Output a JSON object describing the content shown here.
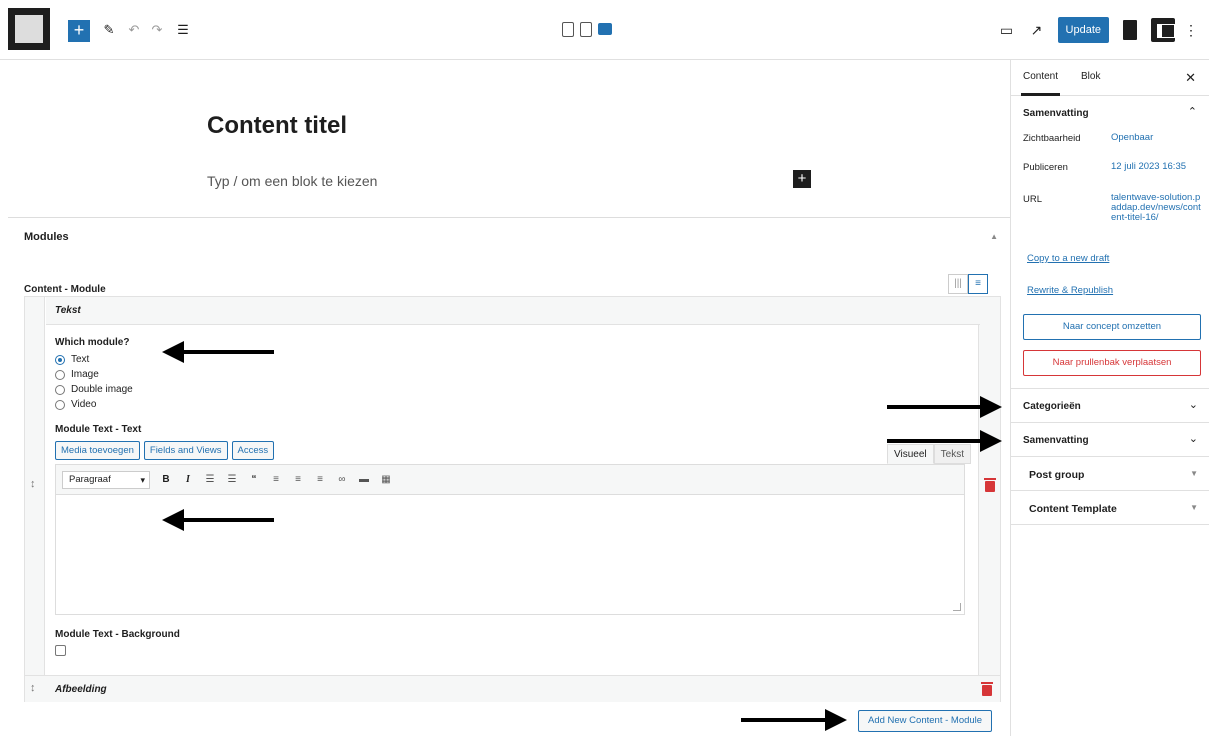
{
  "toolbar": {
    "add_icon": "+",
    "edit_icon": "pencil-icon",
    "undo_icon": "undo-icon",
    "redo_icon": "redo-icon",
    "list_view_icon": "list-view-icon",
    "update_label": "Update"
  },
  "post": {
    "title": "Content titel",
    "block_placeholder": "Typ / om een blok te kiezen"
  },
  "modules": {
    "header": "Modules",
    "group_label": "Content - Module",
    "row1_title": "Tekst",
    "which_module_label": "Which module?",
    "options": [
      "Text",
      "Image",
      "Double image",
      "Video"
    ],
    "selected_option": "Text",
    "text_field_label": "Module Text - Text",
    "media_buttons": [
      "Media toevoegen",
      "Fields and Views",
      "Access"
    ],
    "editor_tabs": [
      "Visueel",
      "Tekst"
    ],
    "format_select": "Paragraaf",
    "background_label": "Module Text - Background",
    "row2_title": "Afbeelding",
    "add_new_label": "Add New Content - Module"
  },
  "sidebar": {
    "tabs": [
      "Content",
      "Blok"
    ],
    "summary_title": "Samenvatting",
    "visibility_label": "Zichtbaarheid",
    "visibility_value": "Openbaar",
    "publish_label": "Publiceren",
    "publish_value": "12 juli 2023 16:35",
    "url_label": "URL",
    "url_value": "talentwave-solution.paddap.dev/news/content-titel-16/",
    "copy_draft": "Copy to a new draft",
    "rewrite": "Rewrite & Republish",
    "to_draft_button": "Naar concept omzetten",
    "to_trash_button": "Naar prullenbak verplaatsen",
    "categories": "Categorieën",
    "summary2": "Samenvatting",
    "post_group": "Post group",
    "content_template": "Content Template"
  },
  "colors": {
    "accent": "#2271b1",
    "danger": "#d63638",
    "dark": "#1e1e1e"
  }
}
